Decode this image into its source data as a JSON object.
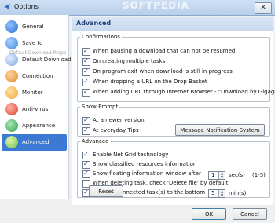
{
  "window": {
    "title": "Options",
    "watermark": "SOFTPEDIA",
    "close_symbol": "✕"
  },
  "sidebar": {
    "items": [
      {
        "label": "General",
        "icon": "globe-icon",
        "color": "#2f6fd0"
      },
      {
        "label": "Save to",
        "icon": "folder-icon",
        "color": "#3d88de"
      },
      {
        "label": "Default Download Pr",
        "icon": "download-icon",
        "color": "#7aa6e0"
      },
      {
        "label": "Connection",
        "icon": "connection-icon",
        "color": "#e08a2a"
      },
      {
        "label": "Monitor",
        "icon": "monitor-icon",
        "color": "#f2a531"
      },
      {
        "label": "Anti-virus",
        "icon": "antivirus-icon",
        "color": "#d9412f"
      },
      {
        "label": "Appearance",
        "icon": "appearance-icon",
        "color": "#2fa34a"
      },
      {
        "label": "Advanced",
        "icon": "advanced-icon",
        "color": "#7bc242"
      }
    ],
    "tooltip": "Default Download Prope"
  },
  "content": {
    "header": "Advanced",
    "confirmations": {
      "legend": "Confirmations",
      "items": [
        {
          "label": "When pausing a download that can not be resumed",
          "checked": true
        },
        {
          "label": "On creating multiple tasks",
          "checked": true
        },
        {
          "label": "On program exit when download is still in progress",
          "checked": true
        },
        {
          "label": "When dropping a URL on the Drop Basket",
          "checked": true
        },
        {
          "label": "When adding URL through Internet Browser - \"Download by Gigaget\"",
          "checked": true
        }
      ]
    },
    "show_prompt": {
      "legend": "Show Prompt",
      "items": [
        {
          "label": "At a newer version",
          "checked": true
        },
        {
          "label": "At everyday Tips",
          "checked": true
        }
      ],
      "button": "Message Notification System"
    },
    "advanced": {
      "legend": "Advanced",
      "items": [
        {
          "label": "Enable Net Grid technology",
          "checked": true
        },
        {
          "label": "Show classified resources information",
          "checked": true
        },
        {
          "label": "Show floating information window after",
          "checked": true
        },
        {
          "label": "When deleting task, check 'Delete file' by default",
          "checked": false
        },
        {
          "label": "Move unconnected task(s) to the bottom",
          "checked": true
        }
      ],
      "float_value": "1",
      "float_unit": "sec(s)",
      "float_range": "(1-5)",
      "move_value": "5",
      "move_unit": "min(s)"
    },
    "reset_label": "Reset"
  },
  "footer": {
    "ok_label": "OK",
    "cancel_label": "Cancel"
  }
}
